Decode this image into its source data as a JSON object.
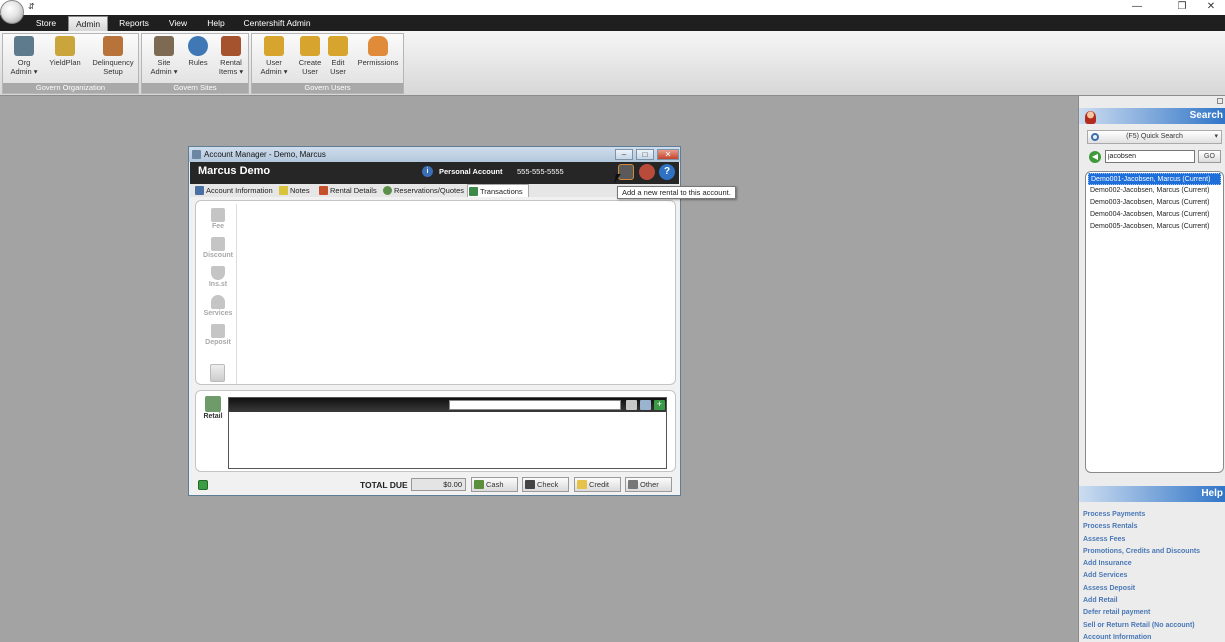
{
  "window": {
    "quick_access": "⇵",
    "controls": [
      "—",
      "❐",
      "✕"
    ]
  },
  "menu": {
    "items": [
      {
        "label": "Store",
        "active": false
      },
      {
        "label": "Admin",
        "active": true
      },
      {
        "label": "Reports",
        "active": false
      },
      {
        "label": "View",
        "active": false
      },
      {
        "label": "Help",
        "active": false
      },
      {
        "label": "Centershift Admin",
        "active": false
      }
    ]
  },
  "ribbon": {
    "groups": [
      {
        "label": "Govern Organization",
        "buttons": [
          {
            "label": "Org\nAdmin ▾",
            "icon": "org-admin-icon",
            "color": "#5e7b8d"
          },
          {
            "label": "YieldPlan",
            "icon": "yieldplan-icon",
            "color": "#c9a53b"
          },
          {
            "label": "Delinquency\nSetup",
            "icon": "delinquency-icon",
            "color": "#b8733a"
          }
        ]
      },
      {
        "label": "Govern Sites",
        "buttons": [
          {
            "label": "Site\nAdmin ▾",
            "icon": "site-admin-icon",
            "color": "#7d6a52"
          },
          {
            "label": "Rules",
            "icon": "rules-icon",
            "color": "#3f78b5"
          },
          {
            "label": "Rental\nItems ▾",
            "icon": "rental-items-icon",
            "color": "#a4532e"
          }
        ]
      },
      {
        "label": "Govern Users",
        "buttons": [
          {
            "label": "User\nAdmin ▾",
            "icon": "user-admin-icon",
            "color": "#d7a52d"
          },
          {
            "label": "Create\nUser",
            "icon": "create-user-icon",
            "color": "#d7a52d"
          },
          {
            "label": "Edit\nUser",
            "icon": "edit-user-icon",
            "color": "#d7a52d"
          },
          {
            "label": "Permissions",
            "icon": "permissions-icon",
            "color": "#e08b3a"
          }
        ]
      }
    ]
  },
  "account_manager": {
    "title": "Account Manager - Demo, Marcus",
    "name": "Marcus Demo",
    "account_type": "Personal Account",
    "phone": "555-555-5555",
    "tabs": [
      {
        "label": "Account Information",
        "icon": "account-info-icon",
        "color": "#4a6fa5",
        "active": false
      },
      {
        "label": "Notes",
        "icon": "notes-icon",
        "color": "#d9c33b",
        "active": false
      },
      {
        "label": "Rental Details",
        "icon": "rental-details-icon",
        "color": "#c4502c",
        "active": false
      },
      {
        "label": "Reservations/Quotes",
        "icon": "reservations-icon",
        "color": "#5b8f4a",
        "active": false
      },
      {
        "label": "Transactions",
        "icon": "transactions-icon",
        "color": "#3d8a4b",
        "active": true
      }
    ],
    "tools": [
      {
        "label": "Fee",
        "icon": "fee-icon"
      },
      {
        "label": "Discount",
        "icon": "discount-icon"
      },
      {
        "label": "Ins.st",
        "icon": "insurance-icon"
      },
      {
        "label": "Services",
        "icon": "services-icon"
      },
      {
        "label": "Deposit",
        "icon": "deposit-icon"
      }
    ],
    "retail_label": "Retail",
    "total_label": "TOTAL DUE",
    "total_value": "$0.00",
    "payments": [
      {
        "label": "Cash",
        "icon": "cash-icon",
        "color": "#5c8f3c"
      },
      {
        "label": "Check",
        "icon": "check-icon",
        "color": "#444444"
      },
      {
        "label": "Credit",
        "icon": "credit-icon",
        "color": "#e6c24a"
      },
      {
        "label": "Other",
        "icon": "other-icon",
        "color": "#777777"
      }
    ],
    "tooltip": "Add a new rental to this account."
  },
  "search_panel": {
    "title": "Search",
    "mode": "(F5) Quick Search",
    "query": "jacobsen",
    "go_label": "GO",
    "results": [
      {
        "label": "Demo001-Jacobsen, Marcus (Current)",
        "selected": true
      },
      {
        "label": "Demo002-Jacobsen, Marcus (Current)",
        "selected": false
      },
      {
        "label": "Demo003-Jacobsen, Marcus (Current)",
        "selected": false
      },
      {
        "label": "Demo004-Jacobsen, Marcus (Current)",
        "selected": false
      },
      {
        "label": "Demo005-Jacobsen, Marcus (Current)",
        "selected": false
      }
    ]
  },
  "help_panel": {
    "title": "Help",
    "links": [
      "Process Payments",
      "Process Rentals",
      "Assess Fees",
      "Promotions, Credits and Discounts",
      "Add Insurance",
      "Add Services",
      "Assess Deposit",
      "Add Retail",
      "Defer retail payment",
      "Sell or Return Retail (No account)",
      "Account Information"
    ]
  }
}
